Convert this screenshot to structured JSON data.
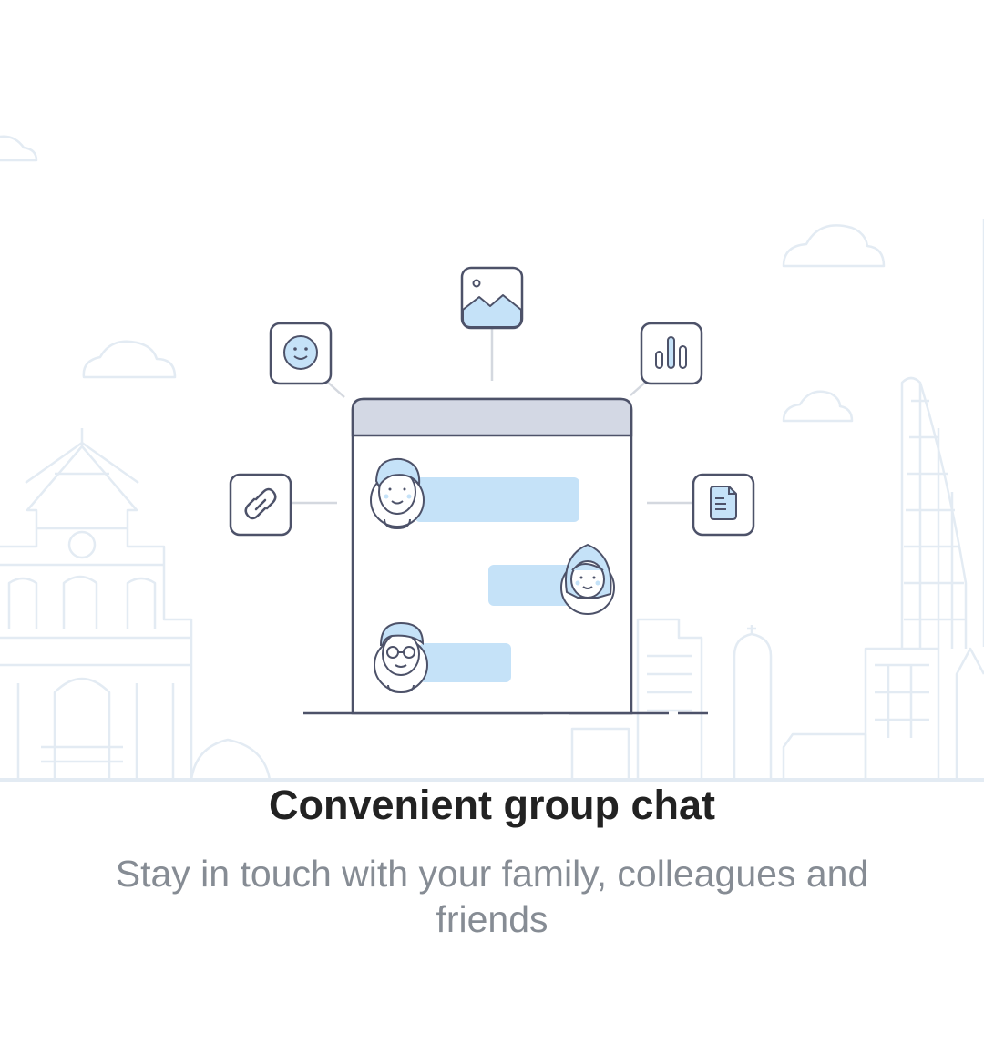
{
  "onboarding": {
    "title": "Convenient group chat",
    "subtitle": "Stay in touch with your family, colleagues and friends"
  },
  "illustration": {
    "center": "chat-window",
    "icons": [
      "link-icon",
      "smiley-icon",
      "image-icon",
      "chart-icon",
      "document-icon"
    ],
    "avatars": [
      "man-avatar",
      "woman-avatar",
      "glasses-man-avatar"
    ],
    "background": "city-skyline"
  },
  "colors": {
    "outline": "#4d5269",
    "accent_fill": "#c5e2f8",
    "window_header": "#d3d8e4",
    "skyline": "#e3ebf3",
    "title_text": "#222222",
    "subtitle_text": "#868c94"
  }
}
